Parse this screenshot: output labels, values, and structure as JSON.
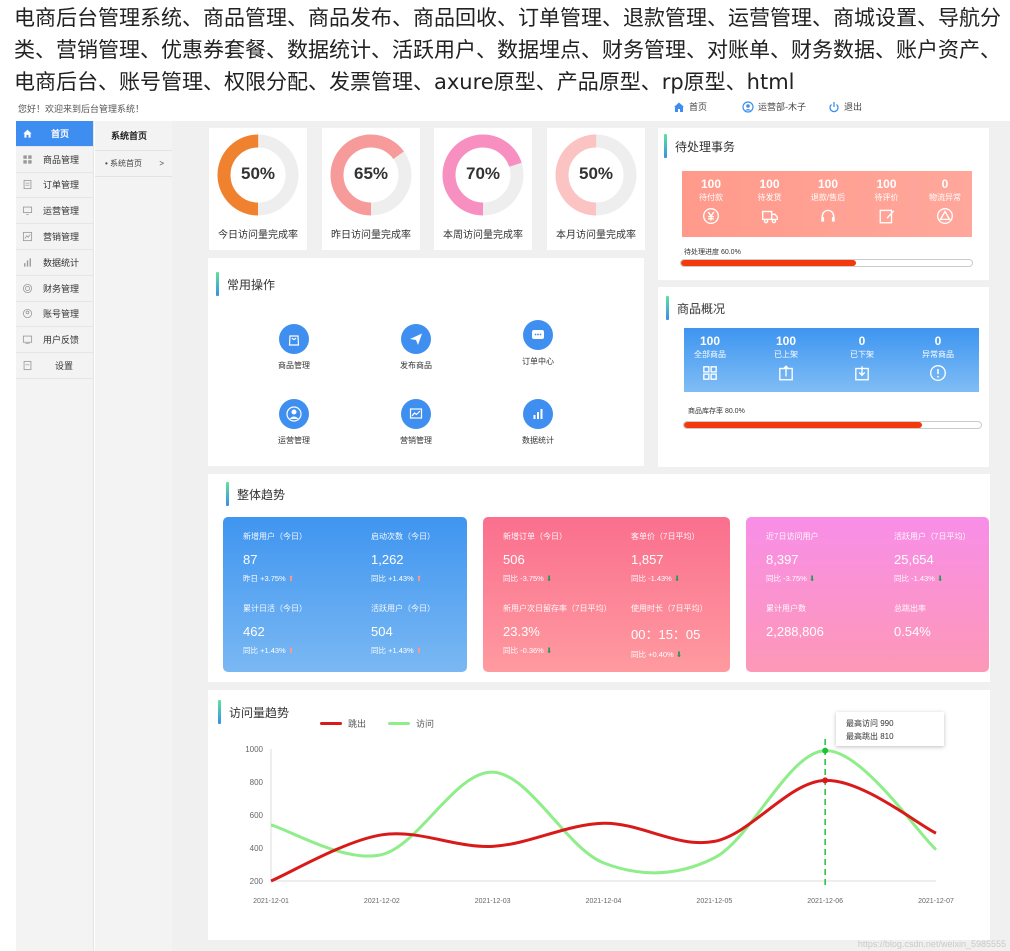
{
  "banner": "电商后台管理系统、商品管理、商品发布、商品回收、订单管理、退款管理、运营管理、商城设置、导航分类、营销管理、优惠券套餐、数据统计、活跃用户、数据埋点、财务管理、对账单、财务数据、账户资产、电商后台、账号管理、权限分配、发票管理、axure原型、产品原型、rp原型、html",
  "topbar": {
    "welcome": "您好！欢迎来到后台管理系统！",
    "home": "首页",
    "user": "运营部-木子",
    "logout": "退出"
  },
  "sidebar": {
    "items": [
      {
        "label": "首页",
        "icon": "home-icon"
      },
      {
        "label": "商品管理",
        "icon": "grid-icon"
      },
      {
        "label": "订单管理",
        "icon": "order-icon"
      },
      {
        "label": "运营管理",
        "icon": "monitor-icon"
      },
      {
        "label": "营销管理",
        "icon": "chart-icon"
      },
      {
        "label": "数据统计",
        "icon": "bars-icon"
      },
      {
        "label": "财务管理",
        "icon": "coin-icon"
      },
      {
        "label": "账号管理",
        "icon": "user-circle-icon"
      },
      {
        "label": "用户反馈",
        "icon": "feedback-icon"
      },
      {
        "label": "设置",
        "icon": "settings-icon"
      }
    ]
  },
  "subside": {
    "head": "系统首页",
    "item": "• 系统首页",
    "arrow": ">"
  },
  "donuts": [
    {
      "pct": "50%",
      "value": 50,
      "label": "今日访问量完成率",
      "color": "#f0812e"
    },
    {
      "pct": "65%",
      "value": 65,
      "label": "昨日访问量完成率",
      "color": "#f79a9a"
    },
    {
      "pct": "70%",
      "value": 70,
      "label": "本周访问量完成率",
      "color": "#f78fc0"
    },
    {
      "pct": "50%",
      "value": 50,
      "label": "本月访问量完成率",
      "color": "#fcc3c3"
    }
  ],
  "ops": {
    "title": "常用操作",
    "items": [
      {
        "label": "商品管理",
        "icon": "bag-icon"
      },
      {
        "label": "发布商品",
        "icon": "paper-plane-icon"
      },
      {
        "label": "订单中心",
        "icon": "message-icon"
      },
      {
        "label": "运营管理",
        "icon": "person-icon"
      },
      {
        "label": "营销管理",
        "icon": "line-chart-icon"
      },
      {
        "label": "数据统计",
        "icon": "bar-chart-icon"
      }
    ]
  },
  "tasks": {
    "title": "待处理事务",
    "stats": [
      {
        "num": "100",
        "label": "待付款",
        "icon": "yen-icon"
      },
      {
        "num": "100",
        "label": "待发货",
        "icon": "truck-icon"
      },
      {
        "num": "100",
        "label": "退款/售后",
        "icon": "headset-icon"
      },
      {
        "num": "100",
        "label": "待评价",
        "icon": "edit-icon"
      },
      {
        "num": "0",
        "label": "物流异常",
        "icon": "warning-icon"
      }
    ],
    "progress_label": "待处理进度 60.0%",
    "progress": 0.6
  },
  "goods": {
    "title": "商品概况",
    "stats": [
      {
        "num": "100",
        "label": "全部商品",
        "icon": "apps-icon"
      },
      {
        "num": "100",
        "label": "已上架",
        "icon": "upload-icon"
      },
      {
        "num": "0",
        "label": "已下架",
        "icon": "download-icon"
      },
      {
        "num": "0",
        "label": "异常商品",
        "icon": "alert-icon"
      }
    ],
    "progress_label": "商品库存率 80.0%",
    "progress": 0.8
  },
  "trend": {
    "title": "整体趋势",
    "cards": [
      {
        "cells": [
          {
            "t": "新增用户（今日）",
            "v": "87",
            "c": "昨日  +3.75%",
            "dir": "up"
          },
          {
            "t": "启动次数（今日）",
            "v": "1,262",
            "c": "同比  +1.43%",
            "dir": "up"
          },
          {
            "t": "累计日活（今日）",
            "v": "462",
            "c": "同比  +1.43%",
            "dir": "up"
          },
          {
            "t": "活跃用户（今日）",
            "v": "504",
            "c": "同比  +1.43%",
            "dir": "up"
          }
        ]
      },
      {
        "cells": [
          {
            "t": "新增订单（今日）",
            "v": "506",
            "c": "同比  -3.75%",
            "dir": "down"
          },
          {
            "t": "客单价（7日平均）",
            "v": "1,857",
            "c": "同比  -1.43%",
            "dir": "down"
          },
          {
            "t": "新用户次日留存率（7日平均）",
            "v": "23.3%",
            "c": "同比  -0.36%",
            "dir": "down"
          },
          {
            "t": "使用时长（7日平均）",
            "v": "00：15：05",
            "c": "同比  +0.40%",
            "dir": "down"
          }
        ]
      },
      {
        "cells": [
          {
            "t": "近7日访问用户",
            "v": "8,397",
            "c": "同比  -3.75%",
            "dir": "down"
          },
          {
            "t": "活跃用户（7日平均）",
            "v": "25,654",
            "c": "同比  -1.43%",
            "dir": "down"
          },
          {
            "t": "累计用户数",
            "v": "2,288,806",
            "c": "",
            "dir": ""
          },
          {
            "t": "总跳出率",
            "v": "0.54%",
            "c": "",
            "dir": ""
          }
        ]
      }
    ]
  },
  "visits": {
    "title": "访问量趋势",
    "tooltip_line1": "最高访问 990",
    "tooltip_line2": "最高跳出 810"
  },
  "chart_data": {
    "type": "line",
    "x": [
      "2021-12-01",
      "2021-12-02",
      "2021-12-03",
      "2021-12-04",
      "2021-12-05",
      "2021-12-06",
      "2021-12-07"
    ],
    "series": [
      {
        "name": "跳出",
        "color": "#d91a1a",
        "values": [
          200,
          480,
          410,
          550,
          440,
          810,
          490
        ]
      },
      {
        "name": "访问",
        "color": "#8fed8a",
        "values": [
          540,
          360,
          860,
          310,
          340,
          990,
          390
        ]
      }
    ],
    "yticks": [
      200,
      400,
      600,
      800,
      1000
    ],
    "ylim": [
      200,
      1000
    ],
    "highlight_index": 5
  },
  "watermark": "https://blog.csdn.net/weixin_5985555"
}
